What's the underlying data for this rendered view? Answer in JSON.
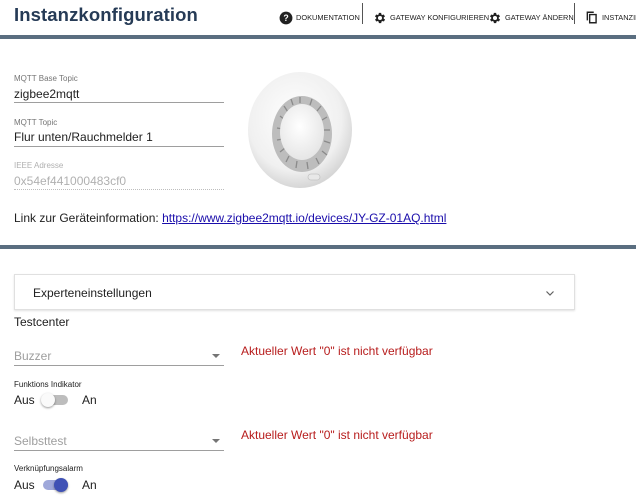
{
  "header": {
    "title": "Instanzkonfiguration",
    "buttons": [
      {
        "label": "DOKUMENTATION",
        "icon": "help-circle-icon"
      },
      {
        "label": "GATEWAY KONFIGURIEREN",
        "icon": "gear-icon"
      },
      {
        "label": "GATEWAY ÄNDERN",
        "icon": "gear-icon"
      },
      {
        "label": "INSTANZID",
        "icon": "copy-icon"
      }
    ]
  },
  "config": {
    "mqtt_base_topic_label": "MQTT Base Topic",
    "mqtt_base_topic_value": "zigbee2mqtt",
    "mqtt_topic_label": "MQTT Topic",
    "mqtt_topic_value": "Flur unten/Rauchmelder 1",
    "ieee_label": "IEEE Adresse",
    "ieee_value": "0x54ef441000483cf0",
    "link_prefix": "Link zur Geräteinformation:",
    "link_text": "https://www.zigbee2mqtt.io/devices/JY-GZ-01AQ.html"
  },
  "expert": {
    "label": "Experteneinstellungen",
    "icon": "chevron-down-icon"
  },
  "testcenter": {
    "title": "Testcenter",
    "buzzer_placeholder": "Buzzer",
    "buzzer_error": "Aktueller Wert \"0\" ist nicht verfügbar",
    "funktions_label": "Funktions Indikator",
    "funktions_off": "Aus",
    "funktions_on": "An",
    "funktions_checked": false,
    "selbsttest_placeholder": "Selbsttest",
    "selbsttest_error": "Aktueller Wert \"0\" ist nicht verfügbar",
    "verknuepfung_label": "Verknüpfungsalarm",
    "verknuepfung_off": "Aus",
    "verknuepfung_on": "An",
    "verknuepfung_checked": true
  },
  "colors": {
    "title": "#263b56",
    "accent_bar": "#5a6e80",
    "error": "#b71c1c",
    "switch_on": "#3f51b5"
  }
}
